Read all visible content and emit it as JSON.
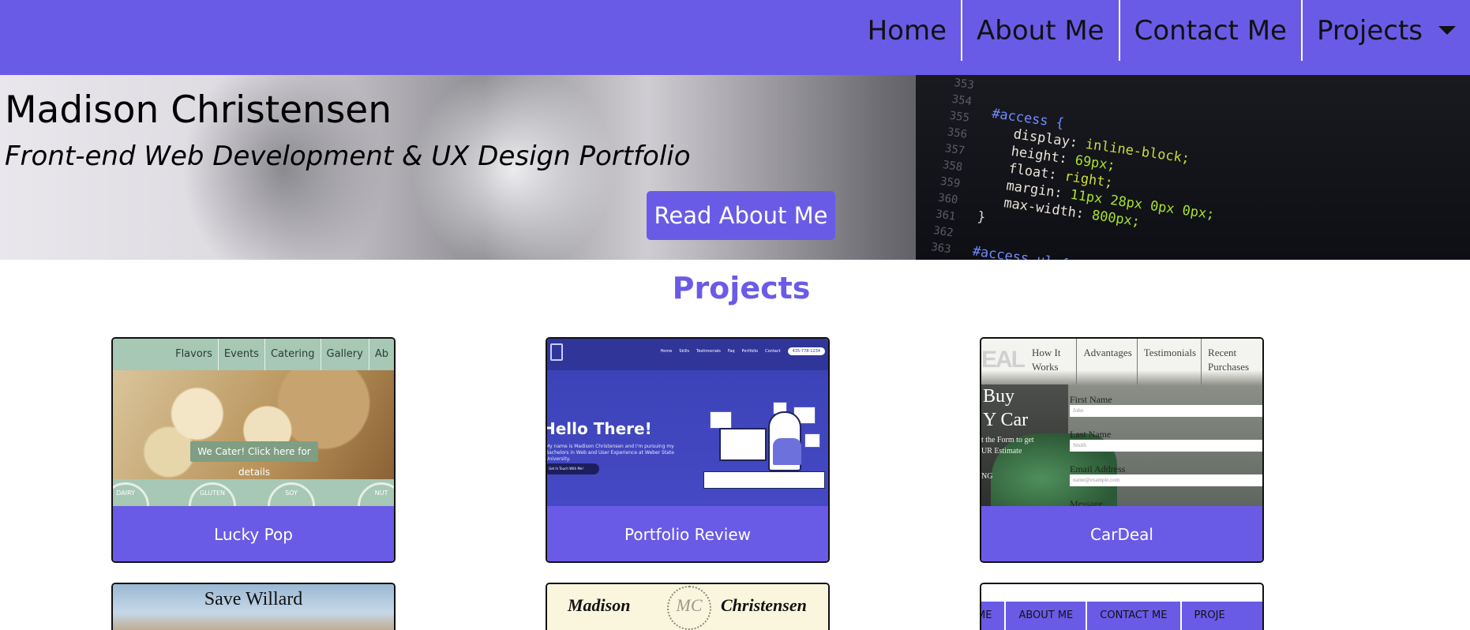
{
  "nav": {
    "items": [
      {
        "label": "Home"
      },
      {
        "label": "About Me"
      },
      {
        "label": "Contact Me"
      },
      {
        "label": "Projects"
      }
    ]
  },
  "hero": {
    "title": "Madison Christensen",
    "subtitle": "Front-end Web Development & UX Design Portfolio",
    "button_label": "Read About Me",
    "code_lines": {
      "gutter": [
        "353",
        "354",
        "355",
        "356",
        "357",
        "358",
        "359",
        "360",
        "361",
        "362",
        "363"
      ],
      "selector": "#access {",
      "display_prop": "display:",
      "display_val": " inline-block;",
      "height_prop": "height:",
      "height_val": " 69px;",
      "float_prop": "float:",
      "float_val": " right;",
      "margin_prop": "margin:",
      "margin_val": " 11px 28px 0px 0px;",
      "maxw_prop": "max-width:",
      "maxw_val": " 800px;",
      "close": "}",
      "next": "#access ul {"
    }
  },
  "projects": {
    "heading": "Projects",
    "cards": [
      {
        "label": "Lucky Pop",
        "thumb": {
          "nav": [
            "Flavors",
            "Events",
            "Catering",
            "Gallery",
            "Ab"
          ],
          "cta": "We Cater! Click here for details",
          "badges": [
            "DAIRY",
            "GLUTEN",
            "SOY",
            "NUT"
          ]
        }
      },
      {
        "label": "Portfolio Review",
        "thumb": {
          "nav": [
            "Home",
            "Skills",
            "Testimonials",
            "Faq",
            "Portfolio",
            "Contact"
          ],
          "phone": "435-778-1234",
          "hello": "Hello There!",
          "intro": "My name is Madison Christensen and I'm pursuing my Bachelors in Web and User Experience at Weber State University.",
          "cta": "Get In Touch With Me!"
        }
      },
      {
        "label": "CarDeal",
        "thumb": {
          "logo": "EAL",
          "nav": [
            "How It Works",
            "Advantages",
            "Testimonials",
            "Recent Purchases"
          ],
          "headline_1": "Buy",
          "headline_2": "Y Car",
          "small_1": "t the Form to get",
          "small_2": "UR Estimate",
          "small_3": "NG",
          "fields": [
            {
              "label": "First Name",
              "placeholder": "John"
            },
            {
              "label": "Last Name",
              "placeholder": "Smith"
            },
            {
              "label": "Email Address",
              "placeholder": "name@example.com"
            }
          ],
          "message_label": "Message"
        }
      },
      {
        "label": "Save Willard",
        "thumb": {
          "title": "Save Willard"
        }
      },
      {
        "label": "Madison Christensen",
        "thumb": {
          "left": "Madison",
          "right": "Christensen",
          "monogram": "MC"
        }
      },
      {
        "label": "",
        "thumb": {
          "nav": [
            "ME",
            "ABOUT ME",
            "CONTACT ME",
            "PROJE"
          ]
        }
      }
    ]
  },
  "colors": {
    "accent": "#6a5be6",
    "white": "#ffffff"
  }
}
